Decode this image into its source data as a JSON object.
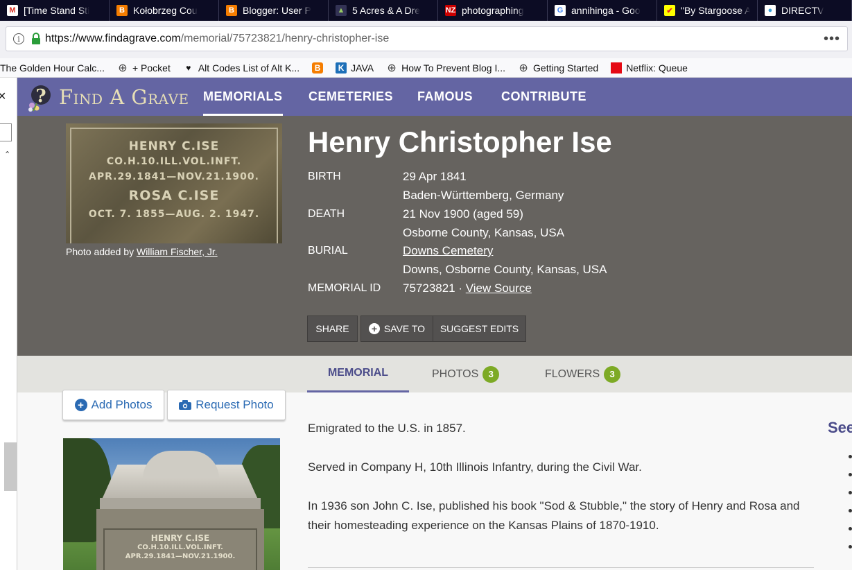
{
  "browser": {
    "tabs": [
      {
        "label": "[Time Stand Sti",
        "icon": "gmail-icon",
        "glyph": "M",
        "color": "#d93025",
        "bg": "#fff",
        "width": 158
      },
      {
        "label": "Kołobrzeg Cou",
        "icon": "blogger-icon",
        "glyph": "B",
        "color": "#fff",
        "bg": "#f57d00",
        "width": 158
      },
      {
        "label": "Blogger: User P",
        "icon": "blogger-icon",
        "glyph": "B",
        "color": "#fff",
        "bg": "#f57d00",
        "width": 158
      },
      {
        "label": "5 Acres & A Dre",
        "icon": "photo-icon",
        "glyph": "▲",
        "color": "#9c6",
        "bg": "#335",
        "width": 158
      },
      {
        "label": "photographing",
        "icon": "nz-icon",
        "glyph": "NZ",
        "color": "#fff",
        "bg": "#c00",
        "width": 158
      },
      {
        "label": "annihinga - Goo",
        "icon": "google-icon",
        "glyph": "G",
        "color": "#4285f4",
        "bg": "#fff",
        "width": 158
      },
      {
        "label": "\"By Stargoose A",
        "icon": "check-icon",
        "glyph": "✔",
        "color": "#e22",
        "bg": "#ff0",
        "width": 145
      },
      {
        "label": "DIRECTV",
        "icon": "att-icon",
        "glyph": "●",
        "color": "#3aa0d8",
        "bg": "#fff",
        "width": 136
      }
    ],
    "url_base": "https://www.findagrave.com",
    "url_path": "/memorial/75723821/henry-christopher-ise",
    "menu_icon": "ellipsis-icon",
    "bookmarks": [
      {
        "label": "The Golden Hour Calc...",
        "icon": ""
      },
      {
        "label": "+ Pocket",
        "icon": "globe-icon",
        "glyph": "⊕"
      },
      {
        "label": "Alt Codes List of Alt K...",
        "icon": "heart-icon",
        "glyph": "♥"
      },
      {
        "label": "",
        "icon": "blogger-icon",
        "glyph": "B"
      },
      {
        "label": "JAVA",
        "icon": "k-icon",
        "glyph": "K"
      },
      {
        "label": "How To Prevent Blog I...",
        "icon": "globe-icon",
        "glyph": "⊕"
      },
      {
        "label": "Getting Started",
        "icon": "globe-icon",
        "glyph": "⊕"
      },
      {
        "label": "Netflix: Queue",
        "icon": "netflix-icon",
        "glyph": "▬"
      }
    ]
  },
  "site": {
    "logo_text": "Find A Grave",
    "nav": [
      "MEMORIALS",
      "CEMETERIES",
      "FAMOUS",
      "CONTRIBUTE"
    ],
    "active_nav": "MEMORIALS"
  },
  "headstone": {
    "lines": [
      "HENRY C.ISE",
      "CO.H.10.ILL.VOL.INFT.",
      "APR.29.1841—NOV.21.1900.",
      "ROSA C.ISE",
      "OCT. 7. 1855—AUG. 2. 1947."
    ]
  },
  "photo_credit": {
    "prefix": "Photo added by ",
    "name": "William Fischer, Jr."
  },
  "person": {
    "name": "Henry Christopher Ise",
    "birth_label": "BIRTH",
    "birth_date": "29 Apr 1841",
    "birth_place": "Baden-Württemberg, Germany",
    "death_label": "DEATH",
    "death_date": "21 Nov 1900 (aged 59)",
    "death_place": "Osborne County, Kansas, USA",
    "burial_label": "BURIAL",
    "burial_cemetery": "Downs Cemetery",
    "burial_place": "Downs, Osborne County, Kansas, USA",
    "memorial_label": "MEMORIAL ID",
    "memorial_id": "75723821 · ",
    "view_source": "View Source"
  },
  "actions": {
    "share": "SHARE",
    "save_to": "SAVE TO",
    "suggest_edits": "SUGGEST EDITS"
  },
  "memorial_tabs": {
    "memorial": "MEMORIAL",
    "photos": "PHOTOS",
    "photos_count": "3",
    "flowers": "FLOWERS",
    "flowers_count": "3"
  },
  "photo_buttons": {
    "add": "Add Photos",
    "request": "Request Photo"
  },
  "photo2_lines": [
    "HENRY C.ISE",
    "CO.H.10.ILL.VOL.INFT.",
    "APR.29.1841—NOV.21.1900."
  ],
  "bio": [
    "Emigrated to the U.S. in 1857.",
    "Served in Company H, 10th Illinois Infantry, during the Civil War.",
    "In 1936 son John C. Ise, published his book \"Sod & Stubble,\" the story of Henry and Rosa and their homesteading experience on the Kansas Plains of 1870-1910."
  ],
  "sidebar_heading": "See"
}
